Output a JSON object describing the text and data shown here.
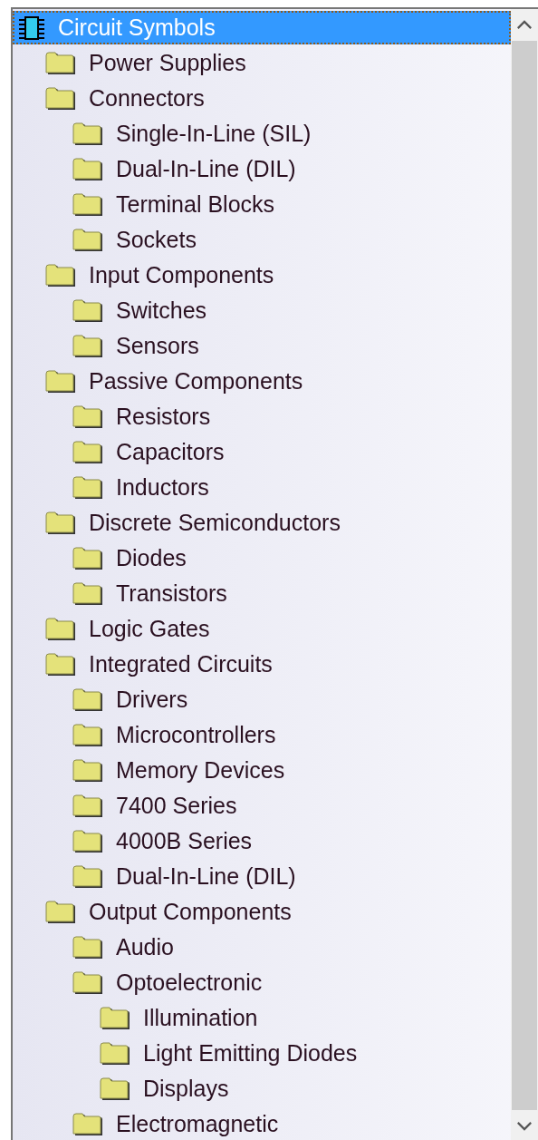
{
  "tree": [
    {
      "label": "Circuit Symbols",
      "selected": true,
      "children": [
        {
          "label": "Power Supplies",
          "selected": false
        },
        {
          "label": "Connectors",
          "selected": false,
          "children": [
            {
              "label": "Single-In-Line (SIL)",
              "selected": false
            },
            {
              "label": "Dual-In-Line (DIL)",
              "selected": false
            },
            {
              "label": "Terminal Blocks",
              "selected": false
            },
            {
              "label": "Sockets",
              "selected": false
            }
          ]
        },
        {
          "label": "Input Components",
          "selected": false,
          "children": [
            {
              "label": "Switches",
              "selected": false
            },
            {
              "label": "Sensors",
              "selected": false
            }
          ]
        },
        {
          "label": "Passive Components",
          "selected": false,
          "children": [
            {
              "label": "Resistors",
              "selected": false
            },
            {
              "label": "Capacitors",
              "selected": false
            },
            {
              "label": "Inductors",
              "selected": false
            }
          ]
        },
        {
          "label": "Discrete Semiconductors",
          "selected": false,
          "children": [
            {
              "label": "Diodes",
              "selected": false
            },
            {
              "label": "Transistors",
              "selected": false
            }
          ]
        },
        {
          "label": "Logic Gates",
          "selected": false
        },
        {
          "label": "Integrated Circuits",
          "selected": false,
          "children": [
            {
              "label": "Drivers",
              "selected": false
            },
            {
              "label": "Microcontrollers",
              "selected": false
            },
            {
              "label": "Memory Devices",
              "selected": false
            },
            {
              "label": "7400 Series",
              "selected": false
            },
            {
              "label": "4000B Series",
              "selected": false
            },
            {
              "label": "Dual-In-Line (DIL)",
              "selected": false
            }
          ]
        },
        {
          "label": "Output Components",
          "selected": false,
          "children": [
            {
              "label": "Audio",
              "selected": false
            },
            {
              "label": "Optoelectronic",
              "selected": false,
              "children": [
                {
                  "label": "Illumination",
                  "selected": false
                },
                {
                  "label": "Light Emitting Diodes",
                  "selected": false
                },
                {
                  "label": "Displays",
                  "selected": false
                }
              ]
            },
            {
              "label": "Electromagnetic",
              "selected": false
            }
          ]
        }
      ]
    }
  ]
}
